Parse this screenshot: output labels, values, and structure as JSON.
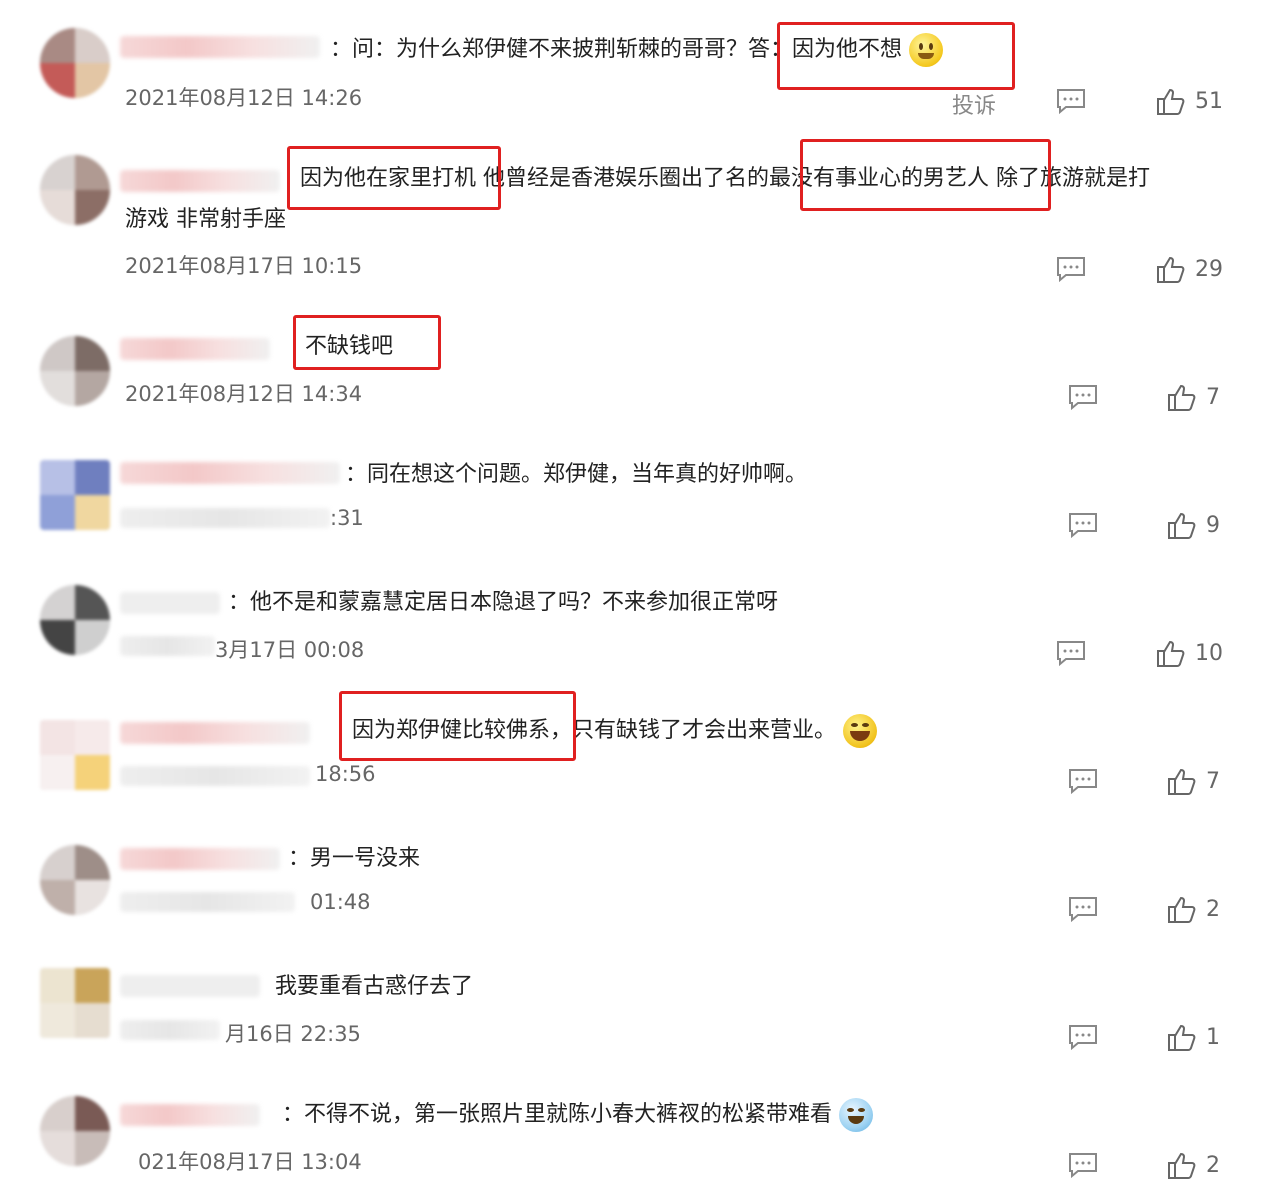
{
  "report_label": "投诉",
  "accent_red": "#e02020",
  "comments": [
    {
      "text": "：问：为什么郑伊健不来披荆斩棘的哥哥？答：因为他不想",
      "time": "2021年08月12日 14:26",
      "likes": "51",
      "emoji": "smile-icon"
    },
    {
      "text_line1": "因为他在家里打机 他曾经是香港娱乐圈出了名的最没有事业心的男艺人 除了旅游就是打",
      "text_line2": "游戏 非常射手座",
      "time": "2021年08月17日 10:15",
      "likes": "29"
    },
    {
      "text": "不缺钱吧",
      "time": "2021年08月12日 14:34",
      "likes": "7"
    },
    {
      "text": "：同在想这个问题。郑伊健，当年真的好帅啊。",
      "time": ":31",
      "likes": "9"
    },
    {
      "text": "：他不是和蒙嘉慧定居日本隐退了吗？不来参加很正常呀",
      "time": "3月17日 00:08",
      "likes": "10"
    },
    {
      "text": "因为郑伊健比较佛系，只有缺钱了才会出来营业。",
      "time": "18:56",
      "likes": "7",
      "emoji": "laughing-emoji-icon"
    },
    {
      "text": "：男一号没来",
      "time": "01:48",
      "likes": "2"
    },
    {
      "text": "我要重看古惑仔去了",
      "time": "月16日 22:35",
      "likes": "1"
    },
    {
      "text": "：不得不说，第一张照片里就陈小春大裤衩的松紧带难看",
      "time": "021年08月17日 13:04",
      "likes": "2",
      "emoji": "crying-laugh-emoji-icon"
    }
  ]
}
